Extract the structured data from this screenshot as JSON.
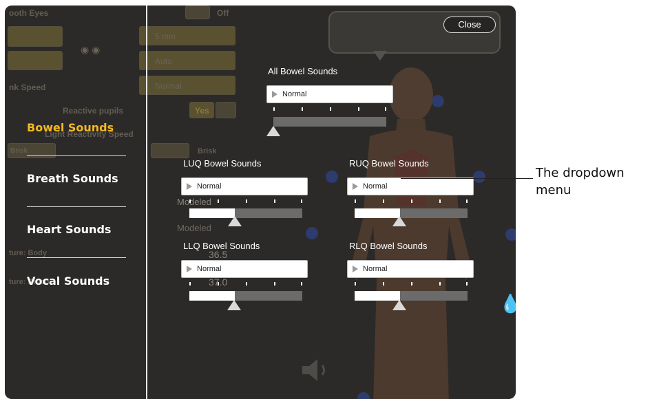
{
  "background_panel": {
    "row1_label": "ooth Eyes",
    "row1_value": "Off",
    "pupil_size": "5 mm",
    "auto": "Auto",
    "blink_speed_label": "nk Speed",
    "blink_speed_value": "Normal",
    "reactive_pupils_label": "Reactive pupils",
    "reactive_pupils_value": "Yes",
    "light_reactivity_label": "Light Reactivity Speed",
    "brisk_left": "Brisk",
    "brisk_right": "Brisk",
    "modeled_1": "Modeled",
    "modeled_2": "Modeled",
    "temp_body_label": "ture: Body",
    "temp_body_value": "36.5",
    "temp_blood_label": "ture: Blood",
    "temp_blood_value": "37.0"
  },
  "close_button": {
    "label": "Close"
  },
  "sidebar": {
    "items": [
      {
        "label": "Bowel Sounds",
        "active": true
      },
      {
        "label": "Breath Sounds",
        "active": false
      },
      {
        "label": "Heart Sounds",
        "active": false
      },
      {
        "label": "Vocal Sounds",
        "active": false
      }
    ]
  },
  "controls": {
    "all": {
      "label": "All Bowel Sounds",
      "value": "Normal",
      "level": 0.0
    },
    "luq": {
      "label": "LUQ Bowel Sounds",
      "value": "Normal",
      "level": 0.4
    },
    "ruq": {
      "label": "RUQ Bowel Sounds",
      "value": "Normal",
      "level": 0.4
    },
    "llq": {
      "label": "LLQ Bowel Sounds",
      "value": "Normal",
      "level": 0.4
    },
    "rlq": {
      "label": "RLQ Bowel Sounds",
      "value": "Normal",
      "level": 0.4
    }
  },
  "icons": {
    "speaker": "speaker-icon",
    "dropdown_arrow": "play-arrow-icon"
  },
  "colors": {
    "active_menu": "#f4b922",
    "panel": "#2c2a28",
    "track_inactive": "#6b6b6b"
  },
  "annotation": {
    "line1": "The dropdown",
    "line2": "menu"
  }
}
